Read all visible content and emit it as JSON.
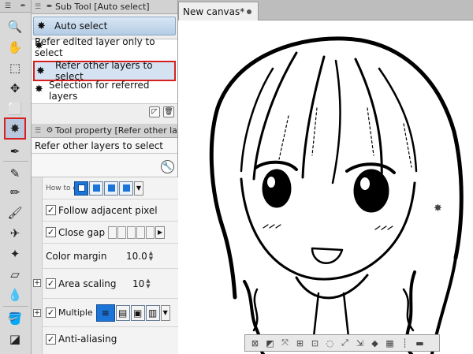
{
  "toolbar": {
    "tools": [
      {
        "name": "zoom-tool-icon",
        "glyph": "🔍"
      },
      {
        "name": "hand-tool-icon",
        "glyph": "✋"
      },
      {
        "name": "operation-tool-icon",
        "glyph": "⬚"
      },
      {
        "name": "move-tool-icon",
        "glyph": "✥"
      },
      {
        "name": "selection-tool-icon",
        "glyph": "⬜"
      },
      {
        "name": "auto-select-tool-icon",
        "glyph": "✸"
      },
      {
        "name": "eyedropper-tool-icon",
        "glyph": "✒"
      },
      {
        "name": "pen-tool-icon",
        "glyph": "✎"
      },
      {
        "name": "pencil-tool-icon",
        "glyph": "✏"
      },
      {
        "name": "brush-tool-icon",
        "glyph": "🖌"
      },
      {
        "name": "airbrush-tool-icon",
        "glyph": "✈"
      },
      {
        "name": "decoration-tool-icon",
        "glyph": "✦"
      },
      {
        "name": "eraser-tool-icon",
        "glyph": "▱"
      },
      {
        "name": "blend-tool-icon",
        "glyph": "💧"
      },
      {
        "name": "fill-tool-icon",
        "glyph": "🪣"
      },
      {
        "name": "gradient-tool-icon",
        "glyph": "◪"
      }
    ]
  },
  "subtool": {
    "title": "Sub Tool [Auto select]",
    "group": "Auto select",
    "items": [
      {
        "label": "Refer edited layer only to select",
        "active": false
      },
      {
        "label": "Refer other layers to select",
        "active": true
      },
      {
        "label": "Selection for referred layers",
        "active": false
      }
    ]
  },
  "toolprop": {
    "title": "Tool property [Refer other la",
    "name": "Refer other layers to select",
    "how_to": "How to c",
    "follow_adjacent": "Follow adjacent pixel",
    "close_gap": "Close gap",
    "color_margin": "Color margin",
    "color_margin_value": "10.0",
    "area_scaling": "Area scaling",
    "area_scaling_value": "10",
    "multiple": "Multiple",
    "anti_aliasing": "Anti-aliasing"
  },
  "canvas": {
    "tab_title": "New canvas*"
  },
  "colors": {
    "highlight_red": "#d62020",
    "selected_blue": "#1b74d8",
    "panel_bg": "#eeeeee"
  }
}
